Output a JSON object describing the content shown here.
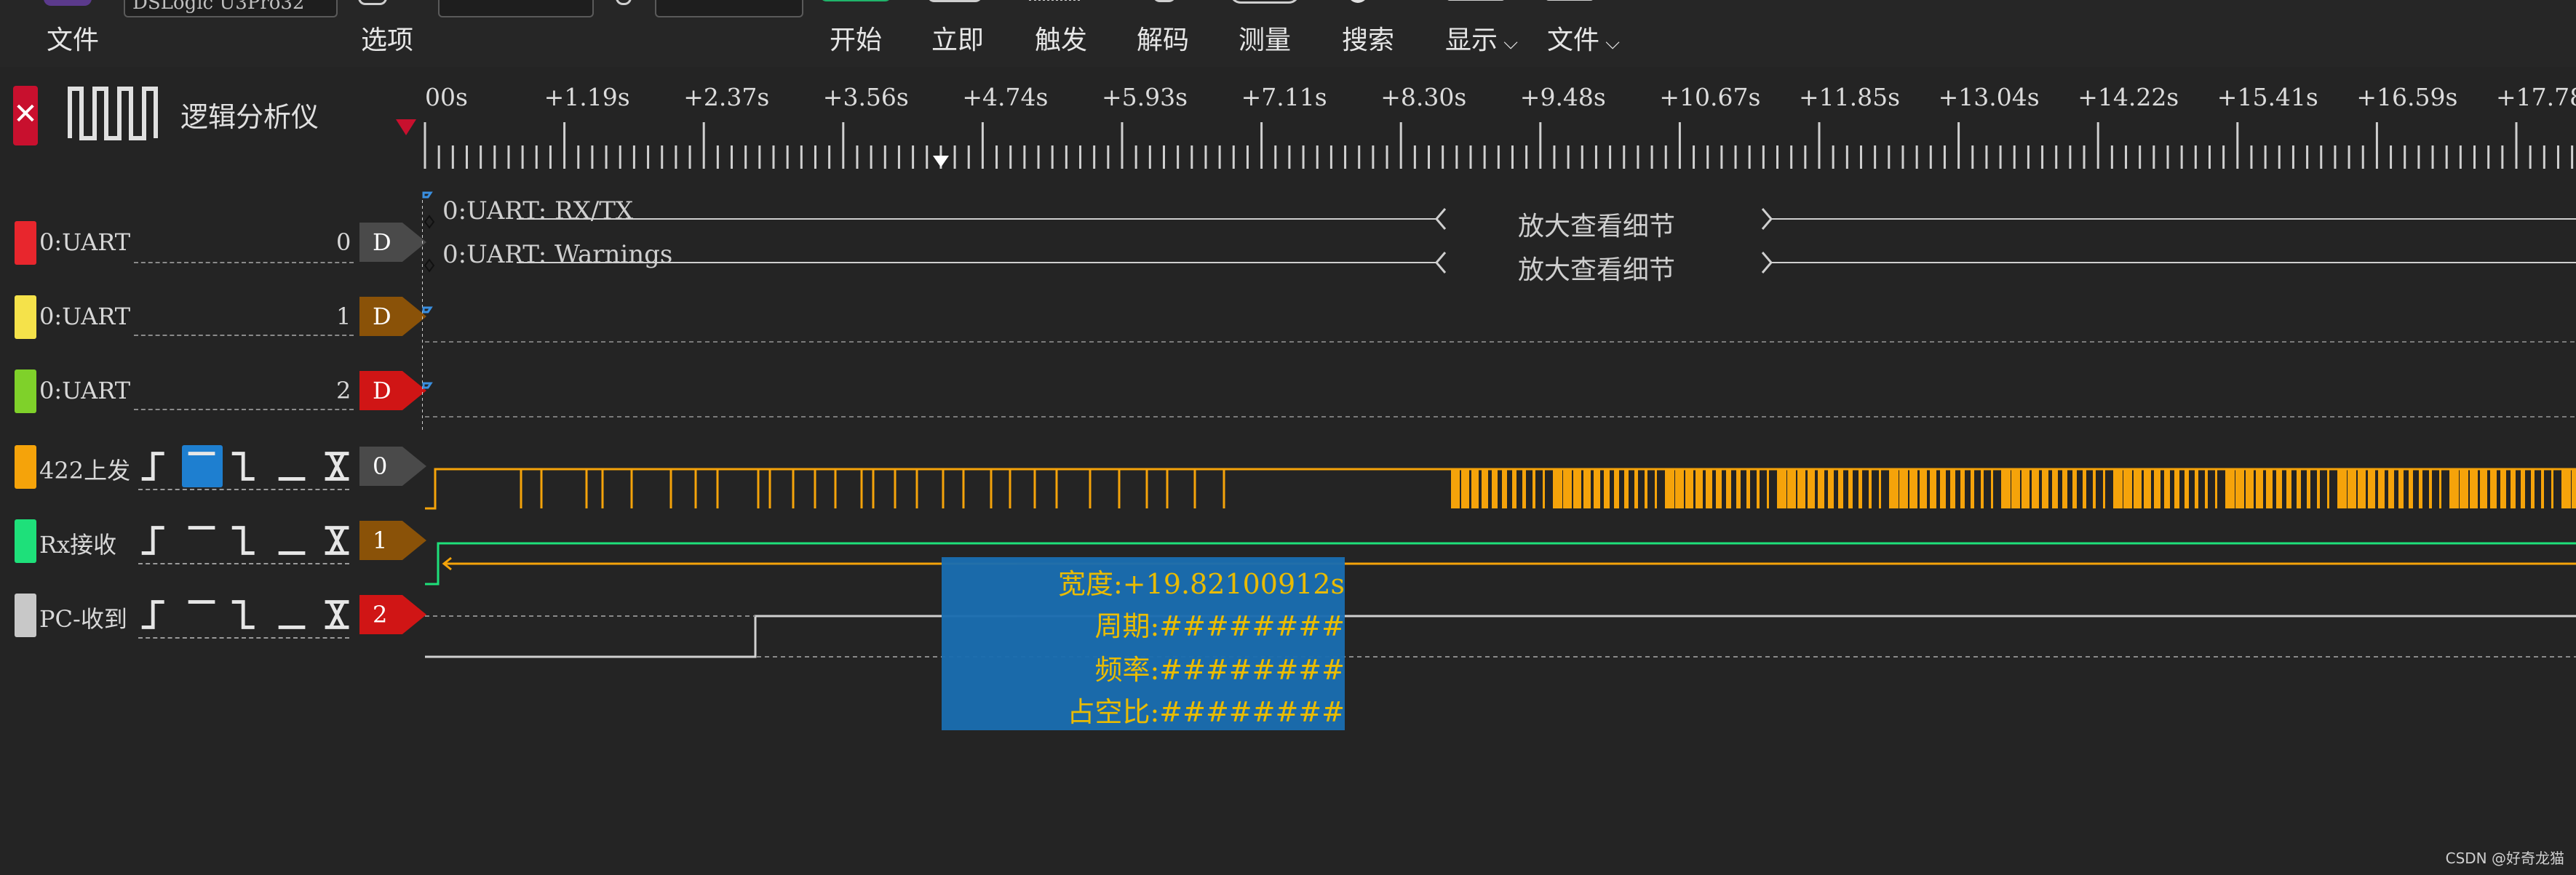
{
  "toolbar": {
    "file_label": "文件",
    "options_label": "选项",
    "device_field": "DSLogic U3Pro32",
    "depth_field": "",
    "rate_field": "",
    "start_label": "开始",
    "instant_label": "立即",
    "trigger_label": "触发",
    "decode_label": "解码",
    "measure_label": "测量",
    "search_label": "搜索",
    "display_label": "显示",
    "file2_label": "文件"
  },
  "device": {
    "name": "逻辑分析仪"
  },
  "ruler": {
    "ticks": [
      "00s",
      "+1.19s",
      "+2.37s",
      "+3.56s",
      "+4.74s",
      "+5.93s",
      "+7.11s",
      "+8.30s",
      "+9.48s",
      "+10.67s",
      "+11.85s",
      "+13.04s",
      "+14.22s",
      "+15.41s",
      "+16.59s",
      "+17.78s"
    ]
  },
  "decoder": {
    "name": "0:UART",
    "num": "0",
    "tag": "D",
    "row_rxtx": "0:UART: RX/TX",
    "row_warnings": "0:UART: Warnings",
    "zoom_hint": "放大查看细节"
  },
  "channels": [
    {
      "name": "0:UART",
      "num": "1",
      "tag": "D",
      "color": "#f5e24a",
      "tag_color": "#8a5208"
    },
    {
      "name": "0:UART",
      "num": "2",
      "tag": "D",
      "color": "#7fd12a",
      "tag_color": "#d01515"
    },
    {
      "name": "422上发",
      "num": "",
      "tag": "0",
      "color": "#f5a30a",
      "tag_color": "#4a4a4a"
    },
    {
      "name": "Rx接收",
      "num": "",
      "tag": "1",
      "color": "#1ee07a",
      "tag_color": "#8a5208"
    },
    {
      "name": "PC-收到",
      "num": "",
      "tag": "2",
      "color": "#c8c8c8",
      "tag_color": "#d01515"
    }
  ],
  "colors": {
    "decoder_channel": "#e8262d",
    "wave_orange": "#f5a30a",
    "wave_green": "#1ee07a",
    "wave_white": "#d0d0d0",
    "measure_bg": "#1a6db0",
    "measure_text": "#f2c200"
  },
  "measure": {
    "width": "宽度:+19.82100912s",
    "period": "周期:########",
    "freq": "频率:########",
    "duty": "占空比:########"
  },
  "watermark": "CSDN @好奇龙猫"
}
